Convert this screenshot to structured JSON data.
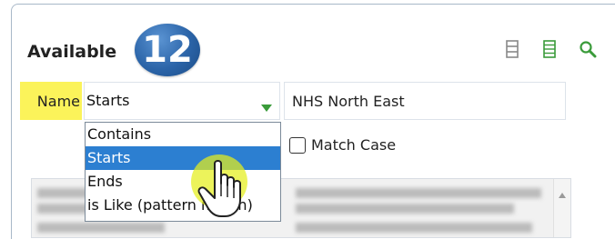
{
  "panel": {
    "title": "Available",
    "step_badge": "12",
    "toolbar": {
      "icons": [
        "compact-list-icon",
        "list-view-icon",
        "search-icon"
      ],
      "colors": {
        "gray": "#888888",
        "green": "#3a9b3a"
      }
    }
  },
  "filter": {
    "field_label": "Name",
    "operator_value": "Starts",
    "value": "NHS North East",
    "match_case_label": "Match Case",
    "match_case_checked": false,
    "operator_options": [
      "Contains",
      "Starts",
      "Ends",
      "is Like (pattern match)"
    ],
    "selected_option": "Starts"
  },
  "colors": {
    "highlight": "#fbf35a",
    "selected_option_bg": "#2c7fd1",
    "badge_blue": "#2b64a8",
    "cursor_halo": "#e4ee1c"
  }
}
